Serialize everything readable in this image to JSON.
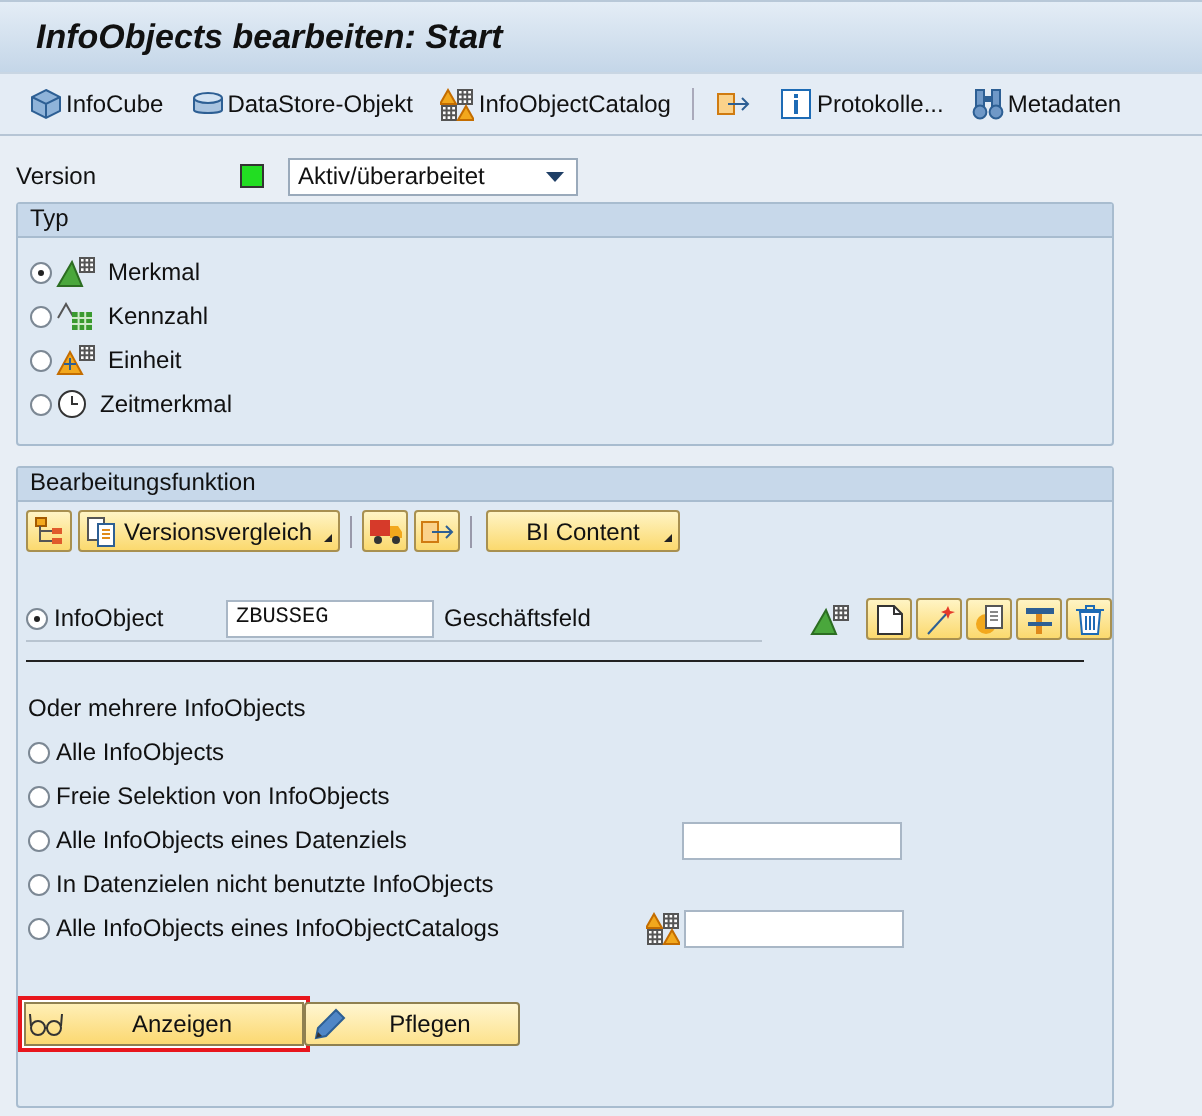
{
  "title": "InfoObjects bearbeiten: Start",
  "toolbar": [
    {
      "kind": "infocube",
      "label": "InfoCube"
    },
    {
      "kind": "datastore",
      "label": "DataStore-Objekt"
    },
    {
      "kind": "catalog",
      "label": "InfoObjectCatalog"
    },
    {
      "kind": "transfer"
    },
    {
      "kind": "log",
      "label": "Protokolle..."
    },
    {
      "kind": "metadata",
      "label": "Metadaten"
    }
  ],
  "version": {
    "label": "Version",
    "value": "Aktiv/überarbeitet"
  },
  "type_group": {
    "title": "Typ",
    "options": [
      {
        "kind": "characteristic",
        "label": "Merkmal",
        "selected": true
      },
      {
        "kind": "key_figure",
        "label": "Kennzahl",
        "selected": false
      },
      {
        "kind": "unit",
        "label": "Einheit",
        "selected": false
      },
      {
        "kind": "time",
        "label": "Zeitmerkmal",
        "selected": false
      }
    ]
  },
  "edit_group": {
    "title": "Bearbeitungsfunktion",
    "menus": [
      {
        "label": "Versionsvergleich"
      },
      {
        "label": "BI Content"
      }
    ],
    "infoobject": {
      "label": "InfoObject",
      "selected": true,
      "value": "ZBUSSEG",
      "description": "Geschäftsfeld"
    },
    "multi_title": "Oder mehrere InfoObjects",
    "multi_options": [
      {
        "label": "Alle InfoObjects",
        "selected": false,
        "kind": "plain"
      },
      {
        "label": "Freie Selektion von InfoObjects",
        "selected": false,
        "kind": "plain"
      },
      {
        "label": "Alle InfoObjects eines Datenziels",
        "selected": false,
        "kind": "field"
      },
      {
        "label": "In Datenzielen nicht benutzte InfoObjects",
        "selected": false,
        "kind": "plain"
      },
      {
        "label": "Alle InfoObjects eines InfoObjectCatalogs",
        "selected": false,
        "kind": "catalog_field"
      }
    ],
    "buttons": [
      {
        "kind": "display",
        "label": "Anzeigen",
        "highlighted": true
      },
      {
        "kind": "maintain",
        "label": "Pflegen",
        "highlighted": false
      }
    ]
  }
}
